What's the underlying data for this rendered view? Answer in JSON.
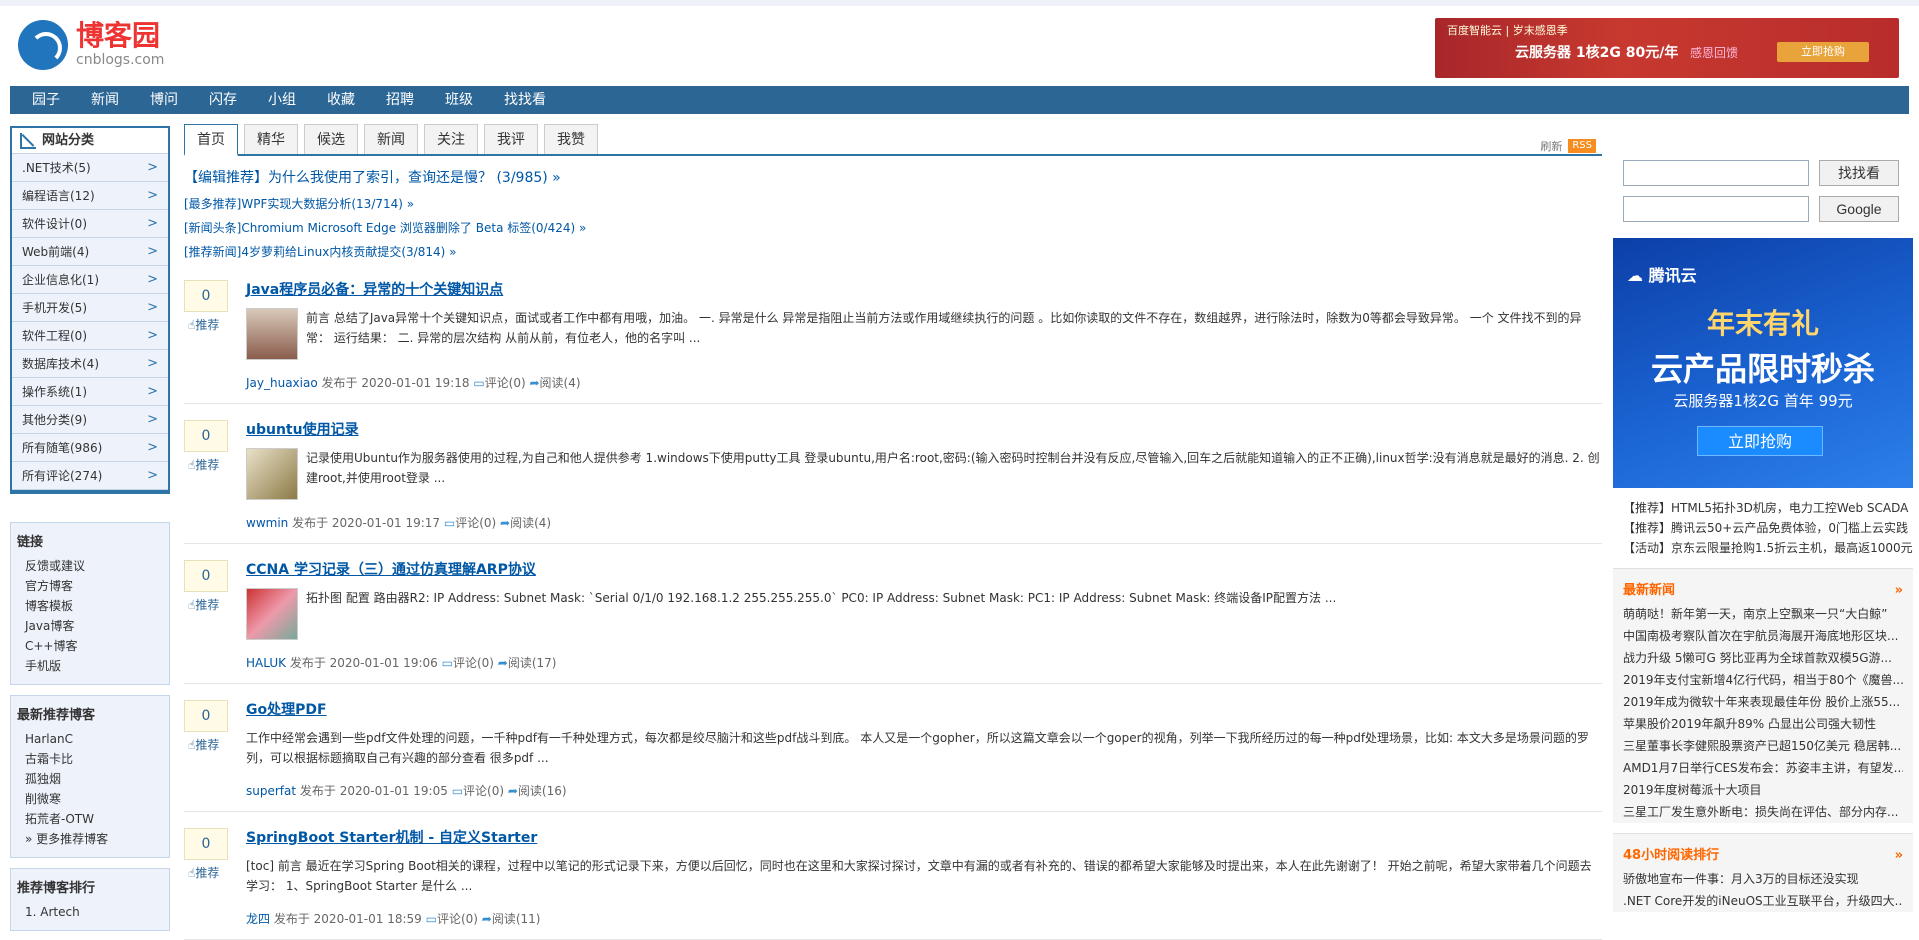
{
  "logo": {
    "cn": "博客园",
    "en": "cnblogs.com"
  },
  "top_ad": {
    "brand": "百度智能云 | 岁末感恩季",
    "main": "云服务器 1核2G 80元/年",
    "sub": "感恩回馈",
    "btn": "立即抢购"
  },
  "nav": [
    "园子",
    "新闻",
    "博问",
    "闪存",
    "小组",
    "收藏",
    "招聘",
    "班级",
    "找找看"
  ],
  "categories": {
    "title": "网站分类",
    "items": [
      ".NET技术(5)",
      "编程语言(12)",
      "软件设计(0)",
      "Web前端(4)",
      "企业信息化(1)",
      "手机开发(5)",
      "软件工程(0)",
      "数据库技术(4)",
      "操作系统(1)",
      "其他分类(9)",
      "所有随笔(986)",
      "所有评论(274)"
    ]
  },
  "links": {
    "title": "链接",
    "items": [
      "反馈或建议",
      "官方博客",
      "博客模板",
      "Java博客",
      "C++博客",
      "手机版"
    ]
  },
  "new_bloggers": {
    "title": "最新推荐博客",
    "items": [
      "HarlanC",
      "古霜卡比",
      "孤独烟",
      "削微寒",
      "拓荒者-OTW",
      "» 更多推荐博客"
    ]
  },
  "rank": {
    "title": "推荐博客排行",
    "items": [
      "1. Artech"
    ]
  },
  "tabs": [
    "首页",
    "精华",
    "候选",
    "新闻",
    "关注",
    "我评",
    "我赞"
  ],
  "tab_right": {
    "refresh": "刷新",
    "rss": "RSS"
  },
  "picks": {
    "main": "【编辑推荐】为什么我使用了索引，查询还是慢？ (3/985) »",
    "items": [
      "[最多推荐]WPF实现大数据分析(13/714) »",
      "[新闻头条]Chromium Microsoft Edge 浏览器删除了 Beta 标签(0/424) »",
      "[推荐新闻]4岁萝莉给Linux内核贡献提交(3/814) »"
    ]
  },
  "posts": [
    {
      "digg": "0",
      "rec": "推荐",
      "title": "Java程序员必备：异常的十个关键知识点",
      "summary": "前言 总结了Java异常十个关键知识点，面试或者工作中都有用哦，加油。 一. 异常是什么 异常是指阻止当前方法或作用域继续执行的问题 。比如你读取的文件不存在，数组越界，进行除法时，除数为0等都会导致异常。 一个 文件找不到的异常：  运行结果：  二. 异常的层次结构 从前从前，有位老人，他的名字叫 ...",
      "author": "Jay_huaxiao",
      "date": "发布于 2020-01-01 19:18",
      "comment": "评论(0)",
      "read": "阅读(4)",
      "thumb": true
    },
    {
      "digg": "0",
      "rec": "推荐",
      "title": "ubuntu使用记录",
      "summary": "记录使用Ubuntu作为服务器使用的过程,为自己和他人提供参考 1.windows下使用putty工具 登录ubuntu,用户名:root,密码:(输入密码时控制台并没有反应,尽管输入,回车之后就能知道输入的正不正确),linux哲学:没有消息就是最好的消息. 2. 创建root,并使用root登录 ...",
      "author": "wwmin",
      "date": "发布于 2020-01-01 19:17",
      "comment": "评论(0)",
      "read": "阅读(4)",
      "thumb": true
    },
    {
      "digg": "0",
      "rec": "推荐",
      "title": "CCNA 学习记录（三）通过仿真理解ARP协议",
      "summary": "拓扑图 配置 路由器R2: IP Address: Subnet Mask: `Serial 0/1/0 192.168.1.2 255.255.255.0` PC0: IP Address: Subnet Mask: PC1: IP Address: Subnet Mask: 终端设备IP配置方法 ...",
      "author": "HALUK",
      "date": "发布于 2020-01-01 19:06",
      "comment": "评论(0)",
      "read": "阅读(17)",
      "thumb": true
    },
    {
      "digg": "0",
      "rec": "推荐",
      "title": "Go处理PDF",
      "summary": "工作中经常会遇到一些pdf文件处理的问题，一千种pdf有一千种处理方式，每次都是绞尽脑汁和这些pdf战斗到底。 本人又是一个gopher，所以这篇文章会以一个goper的视角，列举一下我所经历过的每一种pdf处理场景，比如: 本文大多是场景问题的罗列，可以根据标题摘取自己有兴趣的部分查看 很多pdf ...",
      "author": "superfat",
      "date": "发布于 2020-01-01 19:05",
      "comment": "评论(0)",
      "read": "阅读(16)",
      "thumb": false
    },
    {
      "digg": "0",
      "rec": "推荐",
      "title": "SpringBoot Starter机制 - 自定义Starter",
      "summary": "[toc] 前言 最近在学习Spring Boot相关的课程，过程中以笔记的形式记录下来，方便以后回忆，同时也在这里和大家探讨探讨，文章中有漏的或者有补充的、错误的都希望大家能够及时提出来，本人在此先谢谢了！ 开始之前呢，希望大家带着几个问题去学习： 1、SpringBoot Starter 是什么 ...",
      "author": "龙四",
      "date": "发布于 2020-01-01 18:59",
      "comment": "评论(0)",
      "read": "阅读(11)",
      "thumb": false
    }
  ],
  "search": {
    "btn1": "找找看",
    "btn2": "Google"
  },
  "right_ad": {
    "logo": "腾讯云",
    "h1": "年末有礼",
    "h2": "云产品限时秒杀",
    "h3": "云服务器1核2G  首年 99元",
    "btn": "立即抢购"
  },
  "right_links": [
    "【推荐】HTML5拓扑3D机房，电力工控Web SCADA",
    "【推荐】腾讯云50+云产品免费体验，0门槛上云实践",
    "【活动】京东云限量抢购1.5折云主机，最高返1000元"
  ],
  "latest_news": {
    "title": "最新新闻",
    "more": "»",
    "items": [
      "萌萌哒！新年第一天，南京上空飘来一只“大白鲸”",
      "中国南极考察队首次在宇航员海展开海底地形区块...",
      "战力升级 5懒可G 努比亚再为全球首款双模5G游...",
      "2019年支付宝新增4亿行代码，相当于80个《魔兽...",
      "2019年成为微软十年来表现最佳年份 股价上涨55...",
      "苹果股价2019年飙升89% 凸显出公司强大韧性",
      "三星董事长李健熙股票资产已超150亿美元 稳居韩...",
      "AMD1月7日举行CES发布会：苏姿丰主讲，有望发...",
      "2019年度树莓派十大项目",
      "三星工厂发生意外断电：损失尚在评估、部分内存..."
    ]
  },
  "hot48": {
    "title": "48小时阅读排行",
    "more": "»",
    "items": [
      "骄傲地宣布一件事：月入3万的目标还没实现",
      ".NET Core开发的iNeuOS工业互联平台，升级四大..."
    ]
  }
}
